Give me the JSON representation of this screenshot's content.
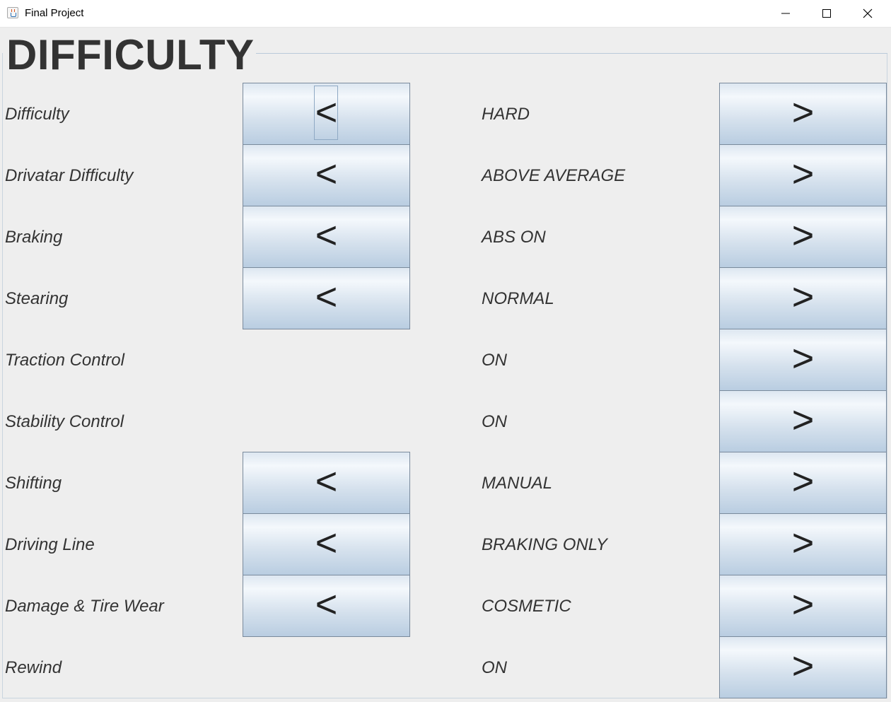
{
  "window": {
    "title": "Final Project",
    "minimize_icon": "minimize-icon",
    "maximize_icon": "maximize-icon",
    "close_icon": "close-icon"
  },
  "heading": "DIFFICULTY",
  "buttons": {
    "prev": "<",
    "next": ">"
  },
  "rows": [
    {
      "label": "Difficulty",
      "value": "HARD",
      "has_prev": true
    },
    {
      "label": "Drivatar Difficulty",
      "value": "ABOVE AVERAGE",
      "has_prev": true
    },
    {
      "label": "Braking",
      "value": "ABS ON",
      "has_prev": true
    },
    {
      "label": "Stearing",
      "value": "NORMAL",
      "has_prev": true
    },
    {
      "label": "Traction Control",
      "value": "ON",
      "has_prev": false
    },
    {
      "label": "Stability Control",
      "value": "ON",
      "has_prev": false
    },
    {
      "label": "Shifting",
      "value": "MANUAL",
      "has_prev": true
    },
    {
      "label": "Driving Line",
      "value": "BRAKING ONLY",
      "has_prev": true
    },
    {
      "label": "Damage & Tire Wear",
      "value": "COSMETIC",
      "has_prev": true
    },
    {
      "label": "Rewind",
      "value": "ON",
      "has_prev": false
    }
  ]
}
